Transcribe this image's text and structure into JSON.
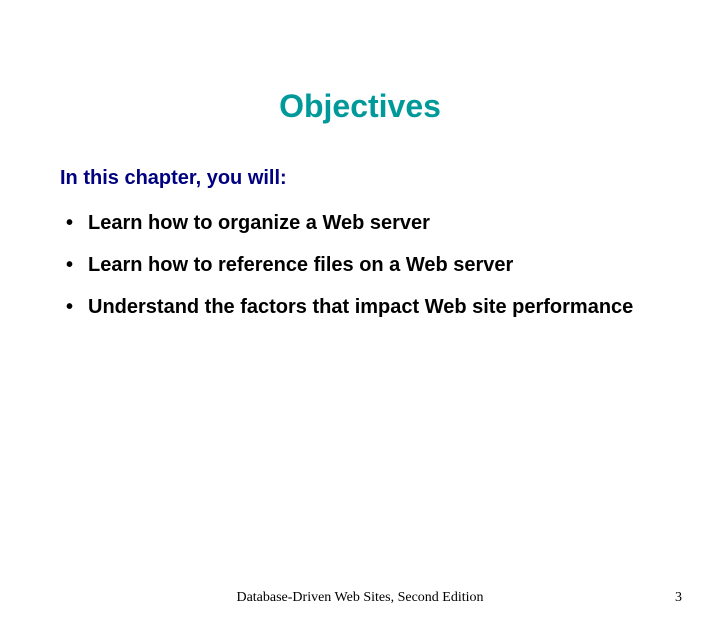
{
  "title": "Objectives",
  "intro": "In this chapter, you will:",
  "bullets": [
    "Learn how to organize a Web server",
    "Learn how to reference files on a Web server",
    "Understand the factors that impact Web site performance"
  ],
  "footer": {
    "center": "Database-Driven Web Sites, Second Edition",
    "page": "3"
  }
}
